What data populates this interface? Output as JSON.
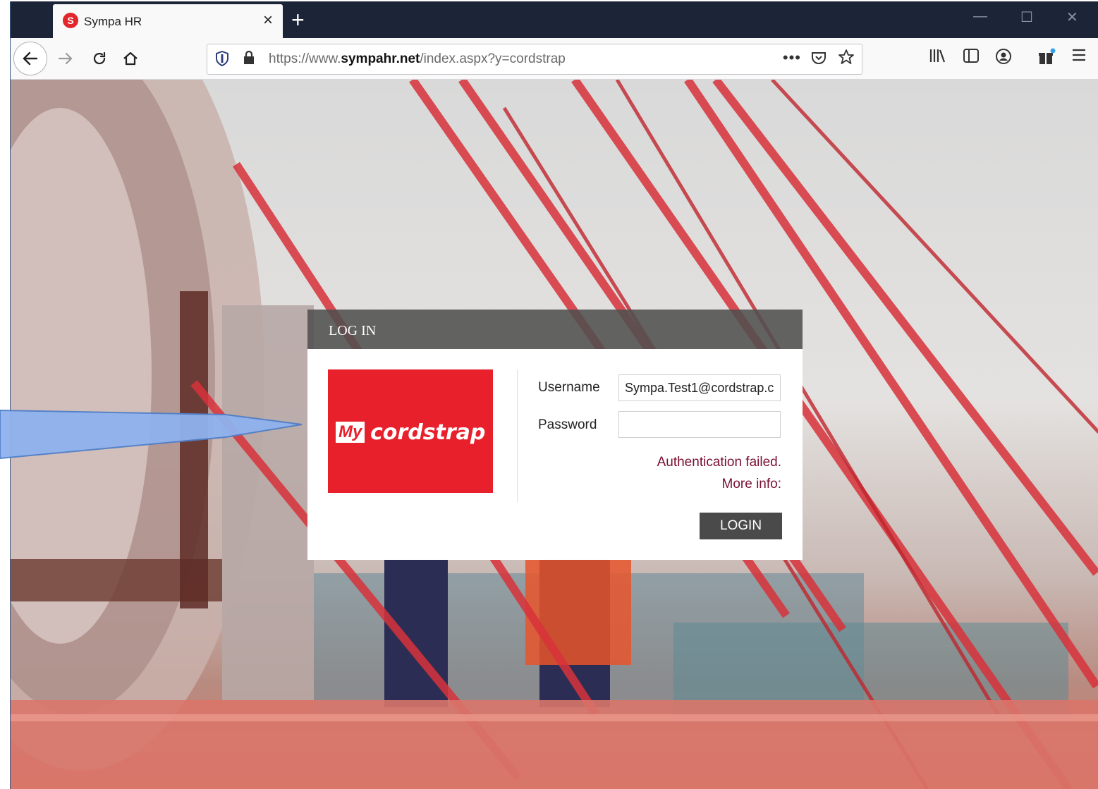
{
  "browser": {
    "tab_title": "Sympa HR",
    "tab_favicon": "S",
    "close_tab": "×",
    "new_tab": "+",
    "url_prefix": "https://www.",
    "url_domain": "sympahr.net",
    "url_path": "/index.aspx?y=cordstrap",
    "page_actions": "•••",
    "window_min": "—",
    "window_max": "☐",
    "window_close": "✕"
  },
  "login": {
    "header": "LOG IN",
    "logo_my": "My",
    "logo_brand": "cordstrap",
    "username_label": "Username",
    "username_value": "Sympa.Test1@cordstrap.c",
    "password_label": "Password",
    "password_value": "",
    "error_message": "Authentication failed.",
    "more_info": "More info:",
    "login_button": "LOGIN"
  },
  "colors": {
    "brand_red": "#e8202b",
    "error_text": "#7a1032",
    "button_bg": "#4a4a4a"
  }
}
